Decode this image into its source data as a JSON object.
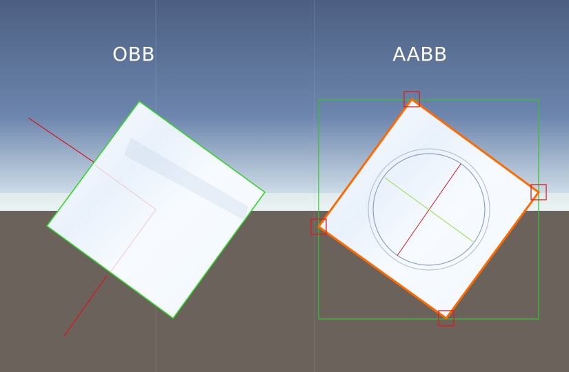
{
  "labels": {
    "obb": "OBB",
    "aabb": "AABB"
  },
  "colors": {
    "sky_top": "#4c5f82",
    "sky_mid": "#6d86ad",
    "sky_horizon": "#e5f1f5",
    "ground": "#6b635b",
    "grid_line": "#8d8a86",
    "cube_face": "#f7fbff",
    "obb_outline": "#35d52a",
    "aabb_box": "#37c232",
    "rotated_outline": "#ff6a00",
    "corner_marker": "#e01b1b",
    "axis_red": "#d9141c",
    "axis_green": "#8fe03f",
    "gizmo_circle": "#8da1c0"
  },
  "icons": {
    "corner_marker": "corner-marker-icon",
    "rotation_gizmo": "rotation-gizmo-icon"
  }
}
